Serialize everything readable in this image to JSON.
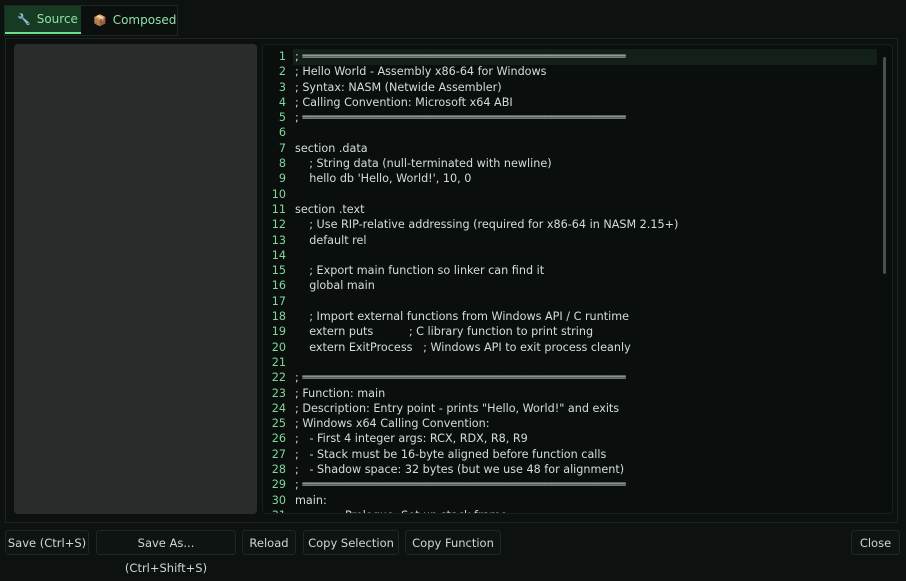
{
  "tabs": [
    {
      "label": "Source",
      "icon": "wrench-icon"
    },
    {
      "label": "Composed",
      "icon": "package-icon"
    }
  ],
  "editor": {
    "lines": [
      "; ════════════════════════════════════════════════",
      "; Hello World - Assembly x86-64 for Windows",
      "; Syntax: NASM (Netwide Assembler)",
      "; Calling Convention: Microsoft x64 ABI",
      "; ════════════════════════════════════════════════",
      "",
      "section .data",
      "    ; String data (null-terminated with newline)",
      "    hello db 'Hello, World!', 10, 0",
      "",
      "section .text",
      "    ; Use RIP-relative addressing (required for x86-64 in NASM 2.15+)",
      "    default rel",
      "",
      "    ; Export main function so linker can find it",
      "    global main",
      "",
      "    ; Import external functions from Windows API / C runtime",
      "    extern puts          ; C library function to print string",
      "    extern ExitProcess   ; Windows API to exit process cleanly",
      "",
      "; ════════════════════════════════════════════════",
      "; Function: main",
      "; Description: Entry point - prints \"Hello, World!\" and exits",
      "; Windows x64 Calling Convention:",
      ";   - First 4 integer args: RCX, RDX, R8, R9",
      ";   - Stack must be 16-byte aligned before function calls",
      ";   - Shadow space: 32 bytes (but we use 48 for alignment)",
      "; ════════════════════════════════════════════════",
      "main:",
      "            ; Prologue: Set up stack frame"
    ]
  },
  "buttons": {
    "save": "Save (Ctrl+S)",
    "save_as": "Save As... (Ctrl+Shift+S)",
    "reload": "Reload",
    "copy_selection": "Copy Selection",
    "copy_function": "Copy Function",
    "close": "Close"
  }
}
